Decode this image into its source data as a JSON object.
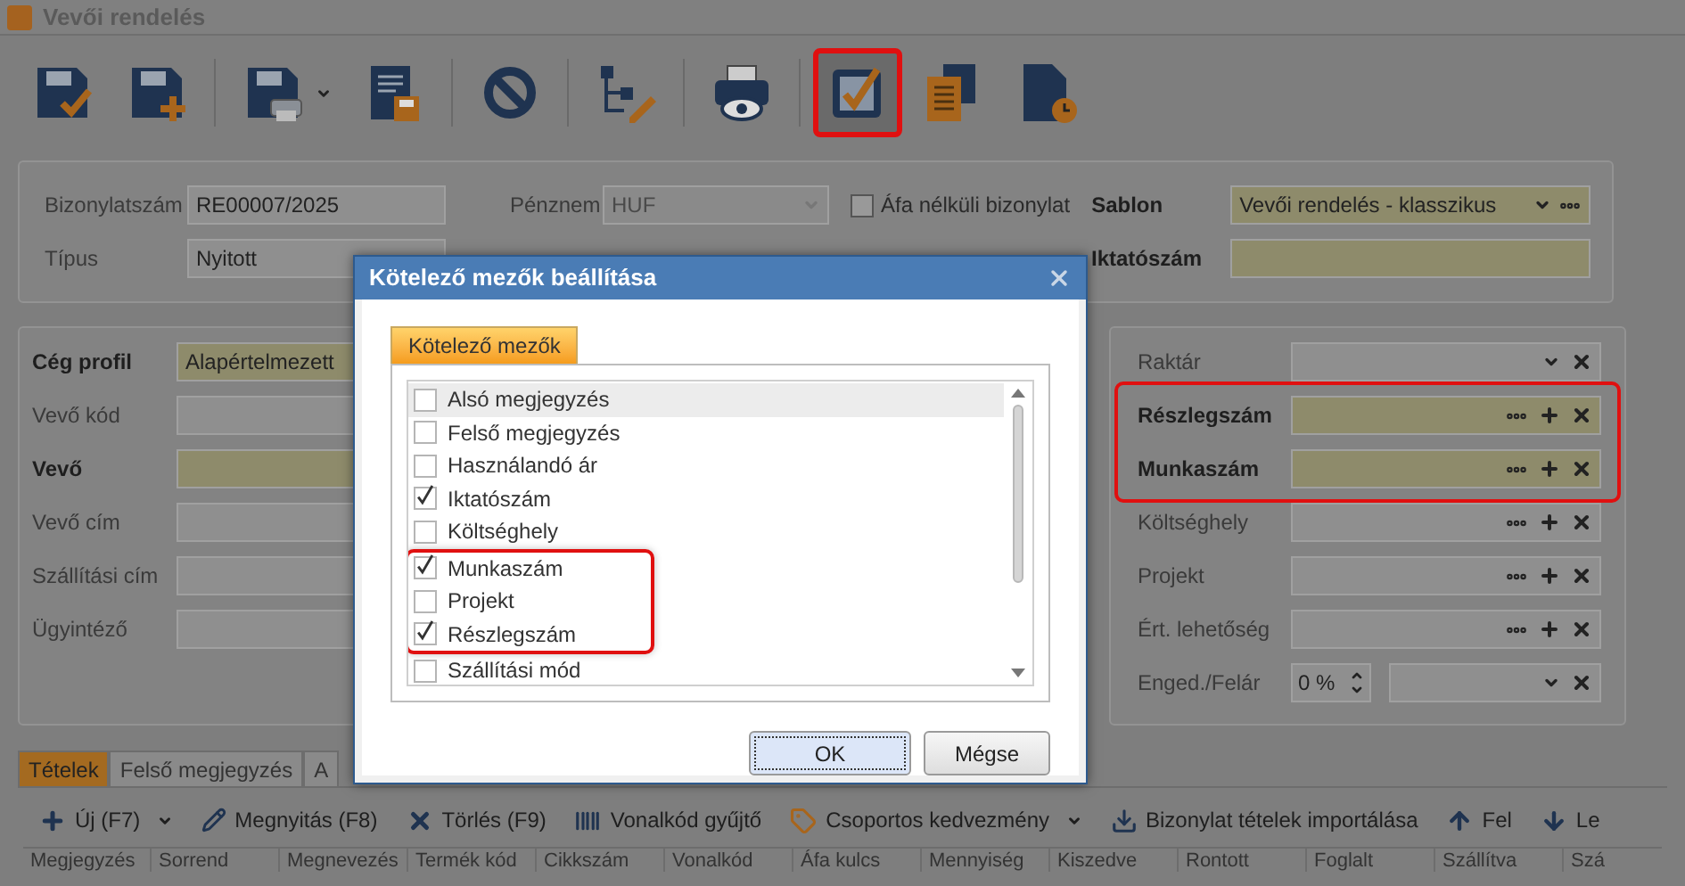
{
  "window": {
    "title": "Vevői rendelés"
  },
  "toolbar": [
    [
      {
        "kind": "save-check",
        "highlighted": false,
        "dropdown": false
      },
      {
        "kind": "save-plus",
        "highlighted": false,
        "dropdown": false
      }
    ],
    [
      {
        "kind": "save-print",
        "highlighted": false,
        "dropdown": true
      },
      {
        "kind": "doc-save",
        "highlighted": false,
        "dropdown": false
      }
    ],
    [
      {
        "kind": "ban",
        "highlighted": false,
        "dropdown": false
      }
    ],
    [
      {
        "kind": "tree-edit",
        "highlighted": false,
        "dropdown": false
      }
    ],
    [
      {
        "kind": "print-preview",
        "highlighted": false,
        "dropdown": false
      }
    ],
    [
      {
        "kind": "checkbox",
        "highlighted": true,
        "dropdown": false
      },
      {
        "kind": "copy",
        "highlighted": false,
        "dropdown": false
      },
      {
        "kind": "doc-clock",
        "highlighted": false,
        "dropdown": false
      }
    ]
  ],
  "header": {
    "row1": [
      {
        "kind": "text",
        "label": "Bizonylatszám",
        "value": "RE00007/2025",
        "required": false
      },
      {
        "kind": "combo",
        "label": "Pénznem",
        "value": "HUF",
        "required": false,
        "disabled": true
      },
      {
        "kind": "checkbox",
        "label": "Áfa nélküli bizonylat",
        "checked": false
      },
      {
        "kind": "combo-lookup",
        "label": "Sablon",
        "value": "Vevői rendelés - klasszikus",
        "required": true
      }
    ],
    "row2": [
      {
        "kind": "text",
        "label": "Típus",
        "value": "Nyitott",
        "required": false
      },
      {
        "kind": "text",
        "label": "Iktatószám",
        "required": true
      }
    ]
  },
  "customer_fields": [
    {
      "label": "Cég profil",
      "value": "Alapértelmezett",
      "required": true
    },
    {
      "label": "Vevő kód",
      "required": false
    },
    {
      "label": "Vevő",
      "required": true
    },
    {
      "label": "Vevő cím",
      "required": false
    },
    {
      "label": "Szállítási cím",
      "required": false
    },
    {
      "label": "Ügyintéző",
      "required": false
    }
  ],
  "side_fields": [
    {
      "kind": "combo",
      "label": "Raktár",
      "required": false,
      "highlighted": false
    },
    {
      "kind": "lookup",
      "label": "Részlegszám",
      "required": true,
      "highlighted": true
    },
    {
      "kind": "lookup",
      "label": "Munkaszám",
      "required": true,
      "highlighted": true
    },
    {
      "kind": "lookup",
      "label": "Költséghely",
      "required": false,
      "highlighted": false
    },
    {
      "kind": "lookup",
      "label": "Projekt",
      "required": false,
      "highlighted": false
    },
    {
      "kind": "lookup",
      "label": "Ért. lehetőség",
      "required": false,
      "highlighted": false
    },
    {
      "kind": "discount",
      "label": "Enged./Felár",
      "value": "0 %",
      "required": false,
      "highlighted": false
    }
  ],
  "dialog": {
    "title": "Kötelező mezők beállítása",
    "tabs": [
      {
        "label": "Kötelező mezők",
        "selected": true
      }
    ],
    "items": [
      {
        "label": "Alsó megjegyzés",
        "checked": false,
        "selected": true,
        "highlighted": false
      },
      {
        "label": "Felső megjegyzés",
        "checked": false,
        "selected": false,
        "highlighted": false
      },
      {
        "label": "Használandó ár",
        "checked": false,
        "selected": false,
        "highlighted": false
      },
      {
        "label": "Iktatószám",
        "checked": true,
        "selected": false,
        "highlighted": false
      },
      {
        "label": "Költséghely",
        "checked": false,
        "selected": false,
        "highlighted": false
      },
      {
        "label": "Munkaszám",
        "checked": true,
        "selected": false,
        "highlighted": true
      },
      {
        "label": "Projekt",
        "checked": false,
        "selected": false,
        "highlighted": true
      },
      {
        "label": "Részlegszám",
        "checked": true,
        "selected": false,
        "highlighted": true
      },
      {
        "label": "Szállítási mód",
        "checked": false,
        "selected": false,
        "highlighted": false
      }
    ],
    "buttons": [
      {
        "label": "OK",
        "focused": true
      },
      {
        "label": "Mégse",
        "focused": false
      }
    ]
  },
  "bottom_tabs": [
    {
      "label": "Tételek",
      "selected": true
    },
    {
      "label": "Felső megjegyzés",
      "selected": false
    },
    {
      "label": "A",
      "selected": false
    }
  ],
  "items_toolbar": [
    {
      "kind": "new",
      "label": "Új (F7)",
      "dropdown": true
    },
    {
      "kind": "open",
      "label": "Megnyitás (F8)",
      "dropdown": false
    },
    {
      "kind": "delete",
      "label": "Törlés (F9)",
      "dropdown": false
    },
    {
      "kind": "barcode",
      "label": "Vonalkód gyűjtő",
      "dropdown": false
    },
    {
      "kind": "tag",
      "label": "Csoportos kedvezmény",
      "dropdown": true
    },
    {
      "kind": "import",
      "label": "Bizonylat tételek importálása",
      "dropdown": false
    },
    {
      "kind": "up",
      "label": "Fel",
      "dropdown": false
    },
    {
      "kind": "down",
      "label": "Le",
      "dropdown": false
    }
  ],
  "table": {
    "columns": [
      "Megjegyzés",
      "Sorrend",
      "Megnevezés",
      "Termék kód",
      "Cikkszám",
      "Vonalkód",
      "Áfa kulcs",
      "Mennyiség",
      "Kiszedve",
      "Rontott",
      "Foglalt",
      "Szállítva",
      "Szá"
    ]
  }
}
